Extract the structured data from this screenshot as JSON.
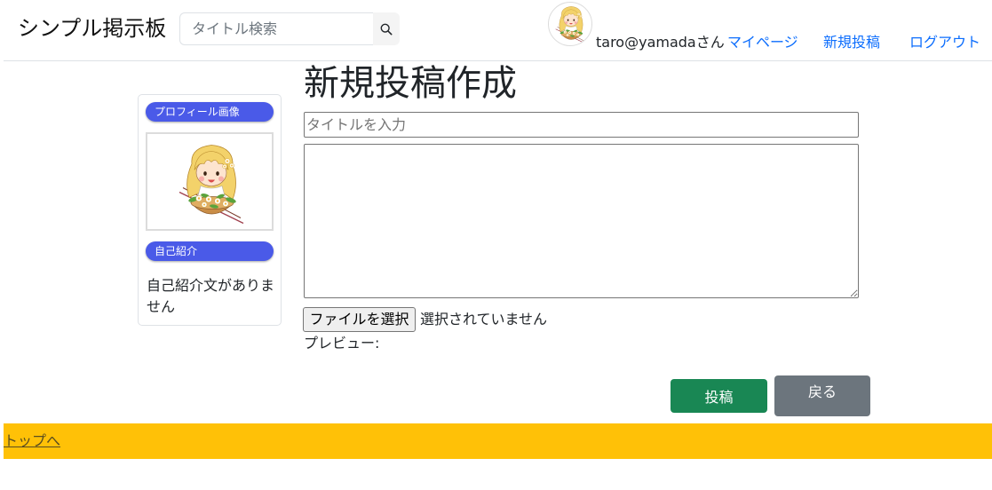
{
  "header": {
    "brand": "シンプル掲示板",
    "search": {
      "placeholder": "タイトル検索",
      "value": ""
    },
    "search_icon": "search-icon",
    "user": {
      "avatar": "user-avatar-illustration",
      "name": "taro@yamadaさん"
    },
    "nav": [
      {
        "label": "マイページ"
      },
      {
        "label": "新規投稿"
      },
      {
        "label": "ログアウト"
      }
    ]
  },
  "sidebar": {
    "profile_image_badge": "プロフィール画像",
    "profile_image": "girl-with-flower-basket-illustration",
    "intro_badge": "自己紹介",
    "intro_text": "自己紹介文がありません"
  },
  "main": {
    "title": "新規投稿作成",
    "title_input": {
      "placeholder": "タイトルを入力",
      "value": ""
    },
    "body_textarea": {
      "value": ""
    },
    "file": {
      "button_label": "ファイルを選択",
      "status": "選択されていません"
    },
    "preview_label": "プレビュー:",
    "submit_label": "投稿",
    "back_label": "戻る"
  },
  "footer": {
    "link": "トップへ"
  },
  "colors": {
    "link": "#0d6efd",
    "badge": "#4a5ae8",
    "submit": "#198754",
    "back": "#6c757d",
    "footer": "#ffc107"
  }
}
